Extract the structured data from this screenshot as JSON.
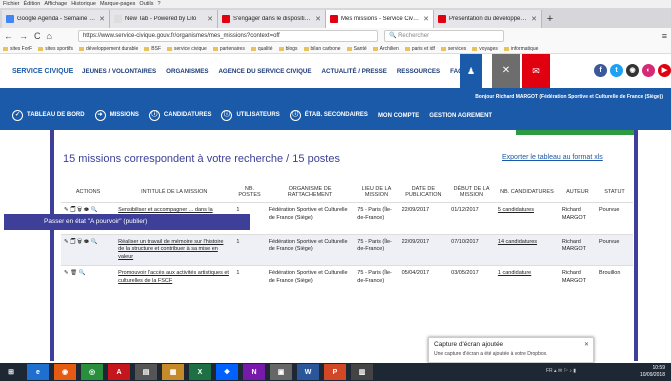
{
  "menubar": [
    "Fichier",
    "Édition",
    "Affichage",
    "Historique",
    "Marque-pages",
    "Outils",
    "?"
  ],
  "tabs": [
    {
      "label": "Google Agenda - Semaine du 1",
      "color": "#4285f4",
      "active": false
    },
    {
      "label": "New Tab - Powered by Lilo",
      "color": "#ddd",
      "active": false
    },
    {
      "label": "S'engager dans le dispositif | Pla",
      "color": "#e1000f",
      "active": false
    },
    {
      "label": "Mes missions - Service Civique",
      "color": "#e1000f",
      "active": true
    },
    {
      "label": "Présentation du développement",
      "color": "#e1000f",
      "active": false
    }
  ],
  "newtab": "+",
  "nav": {
    "back": "←",
    "forward": "→",
    "reload": "C",
    "home": "⌂",
    "url": "https://www.service-civique.gouv.fr/organismes/mes_missions?context=off",
    "search_placeholder": "Rechercher",
    "menu": "≡"
  },
  "bookmarks": [
    "sites ForF",
    "sites sportifs",
    "développement durable",
    "BSF",
    "service civique",
    "partenaires",
    "qualité",
    "blogs",
    "bilan carbone",
    "Santé",
    "Archilien",
    "paris et idf",
    "services",
    "voyages",
    "informatique"
  ],
  "site": {
    "logo": "SERVICE CIVIQUE",
    "nav": [
      "JEUNES / VOLONTAIRES",
      "ORGANISMES",
      "AGENCE DU SERVICE CIVIQUE",
      "ACTUALITÉ / PRESSE",
      "RESSOURCES",
      "FAQS"
    ],
    "btn_person": "♟",
    "btn_close": "✕",
    "btn_mail": "✉",
    "social": [
      {
        "icon": "f",
        "color": "#3b5998"
      },
      {
        "icon": "t",
        "color": "#1da1f2"
      },
      {
        "icon": "◉",
        "color": "#333"
      },
      {
        "icon": "◐",
        "color": "#d62976"
      },
      {
        "icon": "▶",
        "color": "#e1000f"
      }
    ]
  },
  "greeting": "Bonjour Richard MARGOT (Fédération Sportive et Culturelle de France (Siège))",
  "adminnav": [
    {
      "icon": "✓",
      "label": "TABLEAU DE BORD"
    },
    {
      "icon": "➜",
      "label": "MISSIONS"
    },
    {
      "icon": "ⓘ",
      "label": "CANDIDATURES"
    },
    {
      "icon": "ⓘ",
      "label": "UTILISATEURS"
    },
    {
      "icon": "ⓘ",
      "label": "ÉTAB. SECONDAIRES"
    },
    {
      "icon": "",
      "label": "MON COMPTE"
    },
    {
      "icon": "",
      "label": "GESTION AGREMENT"
    }
  ],
  "results": "15 missions correspondent à votre recherche / 15 postes",
  "export": "Exporter le tableau au format xls",
  "table": {
    "headers": [
      "ACTIONS",
      "INTITULÉ DE LA MISSION",
      "NB. POSTES",
      "ORGANISME DE RATTACHEMENT",
      "LIEU DE LA MISSION",
      "DATE DE PUBLICATION",
      "DÉBUT DE LA MISSION",
      "NB. CANDIDATURES",
      "AUTEUR",
      "STATUT"
    ],
    "rows": [
      {
        "actions": "✎ 🗍 🗑 👁 🔍",
        "title": "Sensibiliser et accompagner ... dans la fédération les différents acteurs concernés par la démarche de développement durable",
        "postes": "1",
        "org": "Fédération Sportive et Culturelle de France (Siège)",
        "lieu": "75 - Paris (Île-de-France)",
        "pub": "22/09/2017",
        "debut": "01/12/2017",
        "cand": "5 candidatures",
        "auteur": "Richard MARGOT",
        "statut": "Pourvue"
      },
      {
        "actions": "✎ 🗍 🗑 👁 🔍",
        "title": "Réaliser un travail de mémoire sur l'histoire de la structure et contribuer à sa mise en valeur",
        "postes": "1",
        "org": "Fédération Sportive et Culturelle de France (Siège)",
        "lieu": "75 - Paris (Île-de-France)",
        "pub": "22/09/2017",
        "debut": "07/10/2017",
        "cand": "14 candidatures",
        "auteur": "Richard MARGOT",
        "statut": "Pourvue"
      },
      {
        "actions": "✎ 🗑 🔍",
        "title": "Promouvoir l'accès aux activités artistiques et culturelles de la FSCF",
        "postes": "1",
        "org": "Fédération Sportive et Culturelle de France (Siège)",
        "lieu": "75 - Paris (Île-de-France)",
        "pub": "05/04/2017",
        "debut": "03/05/2017",
        "cand": "1 candidature",
        "auteur": "Richard MARGOT",
        "statut": "Brouillon"
      }
    ]
  },
  "tooltip": "Passer en état \"A pourvoir\" (publier)",
  "notification": {
    "title": "Capture d'écran ajoutée",
    "body": "Une capture d'écran a été ajoutée à votre Dropbox.",
    "close": "✕"
  },
  "taskbar": [
    {
      "label": "⊞",
      "color": "#1e2734"
    },
    {
      "label": "e",
      "color": "#1e6fd0"
    },
    {
      "label": "◉",
      "color": "#e55b13"
    },
    {
      "label": "◎",
      "color": "#2a8f3c"
    },
    {
      "label": "A",
      "color": "#c4161c"
    },
    {
      "label": "▤",
      "color": "#555"
    },
    {
      "label": "▦",
      "color": "#c58b2a"
    },
    {
      "label": "X",
      "color": "#1d7044"
    },
    {
      "label": "❖",
      "color": "#0061fe"
    },
    {
      "label": "N",
      "color": "#7719aa"
    },
    {
      "label": "▣",
      "color": "#666"
    },
    {
      "label": "W",
      "color": "#2b579a"
    },
    {
      "label": "P",
      "color": "#d24726"
    },
    {
      "label": "▥",
      "color": "#444"
    }
  ],
  "clock": {
    "time": "10:59",
    "date": "10/09/2018"
  },
  "tray": "FR ▴ ✉ ⚐ ♪ ▮"
}
